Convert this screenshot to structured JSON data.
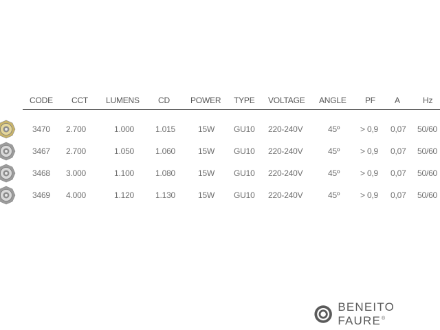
{
  "table": {
    "headers": [
      "CODE",
      "CCT",
      "LUMENS",
      "CD",
      "POWER",
      "TYPE",
      "VOLTAGE",
      "ANGLE",
      "PF",
      "A",
      "Hz"
    ],
    "rows": [
      {
        "finish": "gold",
        "cells": [
          "3470",
          "2.700",
          "1.000",
          "1.015",
          "15W",
          "GU10",
          "220-240V",
          "45º",
          "> 0,9",
          "0,07",
          "50/60"
        ]
      },
      {
        "finish": "silver",
        "cells": [
          "3467",
          "2.700",
          "1.050",
          "1.060",
          "15W",
          "GU10",
          "220-240V",
          "45º",
          "> 0,9",
          "0,07",
          "50/60"
        ]
      },
      {
        "finish": "silver",
        "cells": [
          "3468",
          "3.000",
          "1.100",
          "1.080",
          "15W",
          "GU10",
          "220-240V",
          "45º",
          "> 0,9",
          "0,07",
          "50/60"
        ]
      },
      {
        "finish": "silver",
        "cells": [
          "3469",
          "4.000",
          "1.120",
          "1.130",
          "15W",
          "GU10",
          "220-240V",
          "45º",
          "> 0,9",
          "0,07",
          "50/60"
        ]
      }
    ]
  },
  "brand": {
    "name": "BENEITO FAURE",
    "mark": "®"
  },
  "colors": {
    "gold": "#c9b46a",
    "silver": "#9c9c9c",
    "text": "#6e6e6e",
    "rule": "#3a3a3a"
  },
  "icons": {
    "bulb": "gu10-bulb-icon",
    "logo": "brand-logo-icon"
  }
}
